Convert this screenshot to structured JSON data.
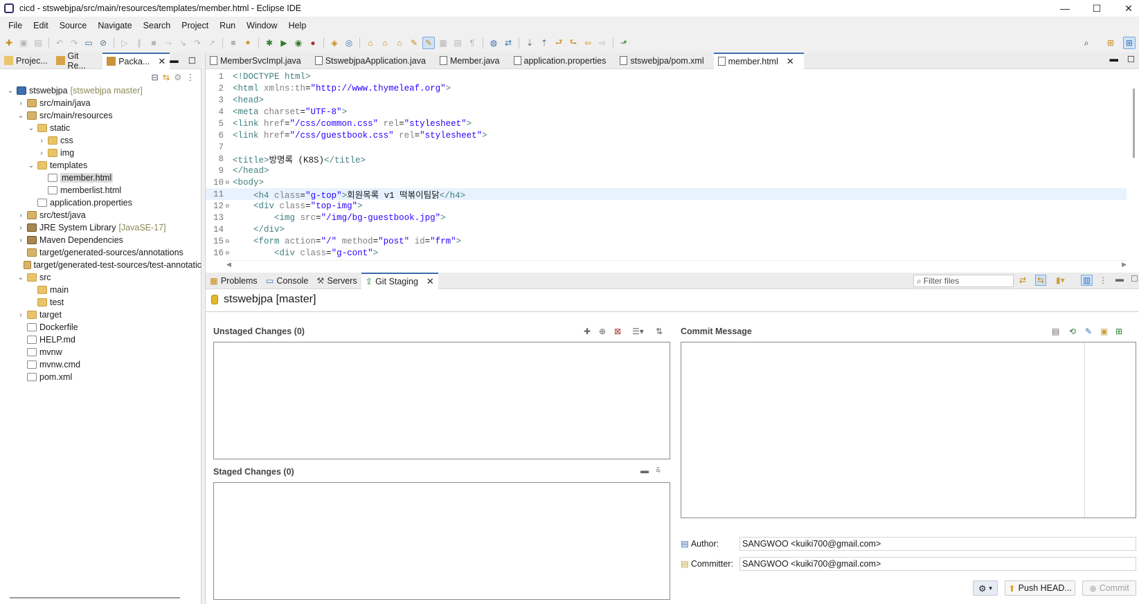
{
  "window": {
    "title": "cicd - stswebjpa/src/main/resources/templates/member.html - Eclipse IDE",
    "minimize": "—",
    "maximize": "☐",
    "close": "✕"
  },
  "menu": [
    "File",
    "Edit",
    "Source",
    "Navigate",
    "Search",
    "Project",
    "Run",
    "Window",
    "Help"
  ],
  "left_view": {
    "tabs": [
      "Projec...",
      "Git Re...",
      "Packa..."
    ],
    "tree": [
      {
        "label": "stswebjpa",
        "decoration": "[stswebjpa master]",
        "twisty": "⌄",
        "kind": "proj"
      },
      {
        "label": "src/main/java",
        "twisty": "›",
        "kind": "pkg"
      },
      {
        "label": "src/main/resources",
        "twisty": "⌄",
        "kind": "pkg"
      },
      {
        "label": "static",
        "twisty": "⌄",
        "kind": "folder"
      },
      {
        "label": "css",
        "twisty": "›",
        "kind": "folder"
      },
      {
        "label": "img",
        "twisty": "›",
        "kind": "folder"
      },
      {
        "label": "templates",
        "twisty": "⌄",
        "kind": "folder"
      },
      {
        "label": "member.html",
        "twisty": "",
        "kind": "file",
        "selected": true
      },
      {
        "label": "memberlist.html",
        "twisty": "",
        "kind": "file"
      },
      {
        "label": "application.properties",
        "twisty": "",
        "kind": "file"
      },
      {
        "label": "src/test/java",
        "twisty": "›",
        "kind": "pkg"
      },
      {
        "label": "JRE System Library",
        "decoration": "[JavaSE-17]",
        "twisty": "›",
        "kind": "lib"
      },
      {
        "label": "Maven Dependencies",
        "twisty": "›",
        "kind": "lib"
      },
      {
        "label": "target/generated-sources/annotations",
        "twisty": "",
        "kind": "pkg"
      },
      {
        "label": "target/generated-test-sources/test-annotatic",
        "twisty": "",
        "kind": "pkg"
      },
      {
        "label": "src",
        "twisty": "⌄",
        "kind": "folder"
      },
      {
        "label": "main",
        "twisty": "",
        "kind": "folder"
      },
      {
        "label": "test",
        "twisty": "",
        "kind": "folder"
      },
      {
        "label": "target",
        "twisty": "›",
        "kind": "folder"
      },
      {
        "label": "Dockerfile",
        "twisty": "",
        "kind": "file"
      },
      {
        "label": "HELP.md",
        "twisty": "",
        "kind": "file"
      },
      {
        "label": "mvnw",
        "twisty": "",
        "kind": "file"
      },
      {
        "label": "mvnw.cmd",
        "twisty": "",
        "kind": "file"
      },
      {
        "label": "pom.xml",
        "twisty": "",
        "kind": "file"
      }
    ]
  },
  "editor": {
    "tabs": [
      "MemberSvcImpl.java",
      "StswebjpaApplication.java",
      "Member.java",
      "application.properties",
      "stswebjpa/pom.xml",
      "member.html"
    ],
    "active_tab": "member.html",
    "lines": [
      {
        "n": "1",
        "fold": "",
        "parts": [
          [
            "dtag",
            "<!DOCTYPE html>"
          ]
        ]
      },
      {
        "n": "2",
        "fold": "",
        "parts": [
          [
            "tg",
            "<html "
          ],
          [
            "at",
            "xmlns:th"
          ],
          [
            "tt",
            "="
          ],
          [
            "av",
            "\"http://www.thymeleaf.org\""
          ],
          [
            "tg",
            ">"
          ]
        ]
      },
      {
        "n": "3",
        "fold": "",
        "parts": [
          [
            "tg",
            "<head>"
          ]
        ]
      },
      {
        "n": "4",
        "fold": "",
        "parts": [
          [
            "tg",
            "<meta "
          ],
          [
            "at",
            "charset"
          ],
          [
            "tt",
            "="
          ],
          [
            "av",
            "\"UTF-8\""
          ],
          [
            "tg",
            ">"
          ]
        ]
      },
      {
        "n": "5",
        "fold": "",
        "parts": [
          [
            "tg",
            "<link "
          ],
          [
            "at",
            "href"
          ],
          [
            "tt",
            "="
          ],
          [
            "av",
            "\"/css/common.css\""
          ],
          [
            "at",
            " rel"
          ],
          [
            "tt",
            "="
          ],
          [
            "av",
            "\"stylesheet\""
          ],
          [
            "tg",
            ">"
          ]
        ]
      },
      {
        "n": "6",
        "fold": "",
        "parts": [
          [
            "tg",
            "<link "
          ],
          [
            "at",
            "href"
          ],
          [
            "tt",
            "="
          ],
          [
            "av",
            "\"/css/guestbook.css\""
          ],
          [
            "at",
            " rel"
          ],
          [
            "tt",
            "="
          ],
          [
            "av",
            "\"stylesheet\""
          ],
          [
            "tg",
            ">"
          ]
        ]
      },
      {
        "n": "7",
        "fold": "",
        "parts": []
      },
      {
        "n": "8",
        "fold": "",
        "parts": [
          [
            "tg",
            "<title>"
          ],
          [
            "tt",
            "방명록 (K8S)"
          ],
          [
            "tg",
            "</title>"
          ]
        ]
      },
      {
        "n": "9",
        "fold": "",
        "parts": [
          [
            "tg",
            "</head>"
          ]
        ]
      },
      {
        "n": "10",
        "fold": "⊖",
        "parts": [
          [
            "tg",
            "<body>"
          ]
        ]
      },
      {
        "n": "11",
        "fold": "",
        "hl": true,
        "parts": [
          [
            "tt",
            "    "
          ],
          [
            "tg",
            "<h4 "
          ],
          [
            "at",
            "class"
          ],
          [
            "tt",
            "="
          ],
          [
            "av",
            "\"g-top\""
          ],
          [
            "tg",
            ">"
          ],
          [
            "tt",
            "회원목록 v1 떡볶이팀닭"
          ],
          [
            "tg",
            "</h4>"
          ]
        ]
      },
      {
        "n": "12",
        "fold": "⊖",
        "parts": [
          [
            "tt",
            "    "
          ],
          [
            "tg",
            "<div "
          ],
          [
            "at",
            "class"
          ],
          [
            "tt",
            "="
          ],
          [
            "av",
            "\"top-img\""
          ],
          [
            "tg",
            ">"
          ]
        ]
      },
      {
        "n": "13",
        "fold": "",
        "parts": [
          [
            "tt",
            "        "
          ],
          [
            "tg",
            "<img "
          ],
          [
            "at",
            "src"
          ],
          [
            "tt",
            "="
          ],
          [
            "av",
            "\"/img/bg-guestbook.jpg\""
          ],
          [
            "tg",
            ">"
          ]
        ]
      },
      {
        "n": "14",
        "fold": "",
        "parts": [
          [
            "tt",
            "    "
          ],
          [
            "tg",
            "</div>"
          ]
        ]
      },
      {
        "n": "15",
        "fold": "⊖",
        "parts": [
          [
            "tt",
            "    "
          ],
          [
            "tg",
            "<form "
          ],
          [
            "at",
            "action"
          ],
          [
            "tt",
            "="
          ],
          [
            "av",
            "\"/\""
          ],
          [
            "at",
            " method"
          ],
          [
            "tt",
            "="
          ],
          [
            "av",
            "\"post\""
          ],
          [
            "at",
            " id"
          ],
          [
            "tt",
            "="
          ],
          [
            "av",
            "\"frm\""
          ],
          [
            "tg",
            ">"
          ]
        ]
      },
      {
        "n": "16",
        "fold": "⊖",
        "parts": [
          [
            "tt",
            "        "
          ],
          [
            "tg",
            "<div "
          ],
          [
            "at",
            "class"
          ],
          [
            "tt",
            "="
          ],
          [
            "av",
            "\"g-cont\""
          ],
          [
            "tg",
            ">"
          ]
        ]
      }
    ]
  },
  "bottom": {
    "tabs": [
      "Problems",
      "Console",
      "Servers",
      "Git Staging"
    ],
    "filter_placeholder": "Filter files",
    "repo_label": "stswebjpa [master]",
    "unstaged_title": "Unstaged Changes (0)",
    "staged_title": "Staged Changes (0)",
    "commit_message_title": "Commit Message",
    "author_label": "Author:",
    "author_value": "SANGWOO <kuiki700@gmail.com>",
    "committer_label": "Committer:",
    "committer_value": "SANGWOO <kuiki700@gmail.com>",
    "push_label": "Push HEAD...",
    "commit_label": "Commit"
  }
}
